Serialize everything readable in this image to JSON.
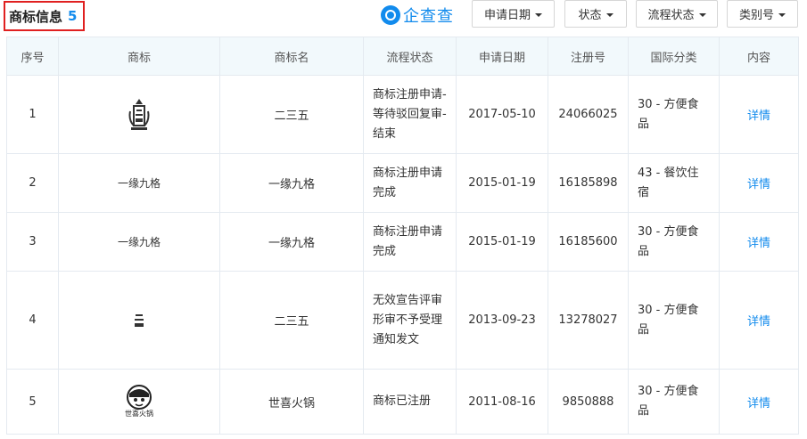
{
  "header": {
    "title": "商标信息",
    "count": "5",
    "brand": "企查查"
  },
  "filters": [
    {
      "label": "申请日期"
    },
    {
      "label": "状态"
    },
    {
      "label": "流程状态"
    },
    {
      "label": "类别号"
    }
  ],
  "table": {
    "columns": [
      "序号",
      "商标",
      "商标名",
      "流程状态",
      "申请日期",
      "注册号",
      "国际分类",
      "内容"
    ],
    "rows": [
      {
        "index": "1",
        "logo_text": "",
        "name": "二三五",
        "status": "商标注册申请-等待驳回复审-结束",
        "date": "2017-05-10",
        "reg_no": "24066025",
        "class": "30 - 方便食品",
        "link": "详情"
      },
      {
        "index": "2",
        "logo_text": "一缘九格",
        "name": "一缘九格",
        "status": "商标注册申请完成",
        "date": "2015-01-19",
        "reg_no": "16185898",
        "class": "43 - 餐饮住宿",
        "link": "详情"
      },
      {
        "index": "3",
        "logo_text": "一缘九格",
        "name": "一缘九格",
        "status": "商标注册申请完成",
        "date": "2015-01-19",
        "reg_no": "16185600",
        "class": "30 - 方便食品",
        "link": "详情"
      },
      {
        "index": "4",
        "logo_text": "",
        "name": "二三五",
        "status": "无效宣告评审形审不予受理通知发文",
        "date": "2013-09-23",
        "reg_no": "13278027",
        "class": "30 - 方便食品",
        "link": "详情"
      },
      {
        "index": "5",
        "logo_text": "世喜火锅",
        "name": "世喜火锅",
        "status": "商标已注册",
        "date": "2011-08-16",
        "reg_no": "9850888",
        "class": "30 - 方便食品",
        "link": "详情"
      }
    ]
  }
}
